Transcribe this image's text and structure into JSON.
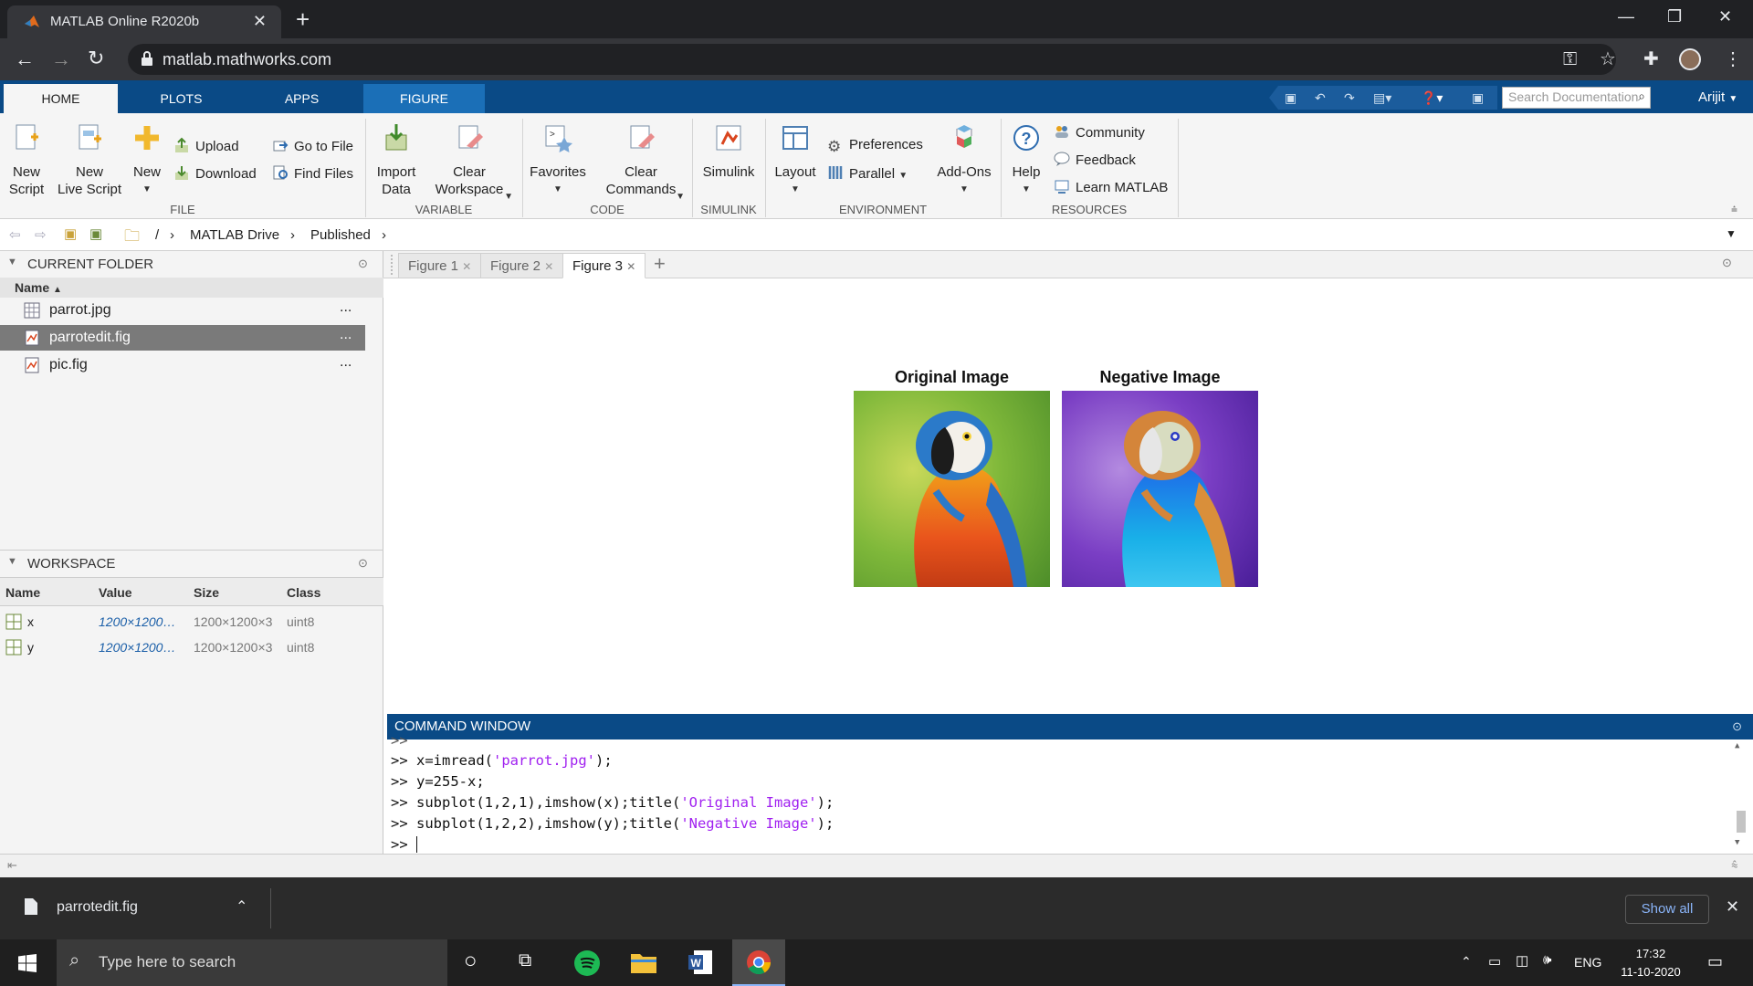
{
  "browser": {
    "tab_title": "MATLAB Online R2020b",
    "url": "matlab.mathworks.com"
  },
  "toolstrip": {
    "tabs": [
      "HOME",
      "PLOTS",
      "APPS",
      "FIGURE"
    ],
    "search_placeholder": "Search Documentation",
    "user": "Arijit"
  },
  "ribbon": {
    "file": {
      "new_script": "New\nScript",
      "new_live_script": "New\nLive Script",
      "new": "New",
      "upload": "Upload",
      "download": "Download",
      "go_to_file": "Go to File",
      "find_files": "Find Files",
      "label": "FILE"
    },
    "variable": {
      "import_data": "Import\nData",
      "clear_workspace": "Clear\nWorkspace",
      "label": "VARIABLE"
    },
    "code": {
      "favorites": "Favorites",
      "clear_commands": "Clear\nCommands",
      "label": "CODE"
    },
    "simulink": {
      "simulink": "Simulink",
      "label": "SIMULINK"
    },
    "environment": {
      "layout": "Layout",
      "preferences": "Preferences",
      "parallel": "Parallel",
      "add_ons": "Add-Ons",
      "label": "ENVIRONMENT"
    },
    "resources": {
      "help": "Help",
      "community": "Community",
      "feedback": "Feedback",
      "learn_matlab": "Learn MATLAB",
      "label": "RESOURCES"
    }
  },
  "path": {
    "sep": "/",
    "drive": "MATLAB Drive",
    "folder": "Published"
  },
  "current_folder": {
    "title": "CURRENT FOLDER",
    "column": "Name",
    "files": [
      {
        "name": "parrot.jpg",
        "more": "..."
      },
      {
        "name": "parrotedit.fig",
        "more": "..."
      },
      {
        "name": "pic.fig",
        "more": "..."
      }
    ]
  },
  "workspace": {
    "title": "WORKSPACE",
    "columns": [
      "Name",
      "Value",
      "Size",
      "Class"
    ],
    "rows": [
      {
        "name": "x",
        "value": "1200×1200…",
        "size": "1200×1200×3",
        "class": "uint8"
      },
      {
        "name": "y",
        "value": "1200×1200…",
        "size": "1200×1200×3",
        "class": "uint8"
      }
    ]
  },
  "figures": {
    "tabs": [
      "Figure 1",
      "Figure 2",
      "Figure 3"
    ],
    "active": "Figure 3",
    "original_title": "Original Image",
    "negative_title": "Negative Image"
  },
  "command_window": {
    "title": "COMMAND WINDOW",
    "prompt": ">>",
    "lines": [
      {
        "code_a": "x=imread(",
        "str": "'parrot.jpg'",
        "code_b": ");"
      },
      {
        "code_a": "y=255-x;",
        "str": "",
        "code_b": ""
      },
      {
        "code_a": "subplot(1,2,1),imshow(x);title(",
        "str": "'Original Image'",
        "code_b": ");"
      },
      {
        "code_a": "subplot(1,2,2),imshow(y);title(",
        "str": "'Negative Image'",
        "code_b": ");"
      }
    ]
  },
  "download_bar": {
    "file": "parrotedit.fig",
    "show_all": "Show all"
  },
  "taskbar": {
    "search_placeholder": "Type here to search",
    "lang": "ENG",
    "time": "17:32",
    "date": "11-10-2020"
  },
  "colors": {
    "matlab_blue": "#0a4a86",
    "figure_tab": "#1b6fb7",
    "string_purple": "#a020f0"
  }
}
